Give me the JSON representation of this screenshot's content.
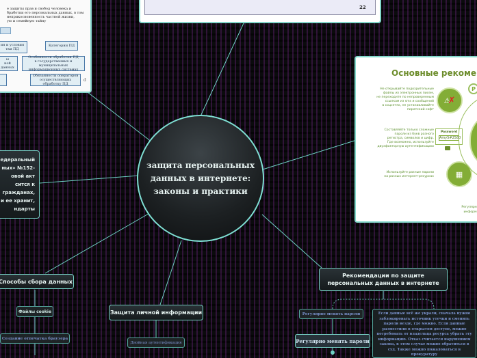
{
  "center": {
    "title": "защита персональных данных в интернете: законы и практики"
  },
  "left_node": {
    "lines": [
      "едеральный",
      "ных» №152-",
      "овой акт",
      "сится к",
      "гражданах,",
      "и ее хранит,",
      "ндарты"
    ]
  },
  "branches": {
    "collection": "Способы сбора данных",
    "protection": "Защита личной информации",
    "recommendations": "Рекомендации по защите персональных данных в интернете"
  },
  "collection_children": {
    "cookies": "Файлы cookie",
    "fingerprint": "Создание отпечатка браузера"
  },
  "protection_children": {
    "twofactor": "Двойная аутентификация"
  },
  "recommendation_children": {
    "change1": "Регулярно менять пароли",
    "change2": "Регулярно менять пароли",
    "leak_text": "Если данные всё же украли, сначала нужно заблокировать источник утечки и сменить пароли везде, где можно. Если данные разместили в открытом доступе, можно потребовать от владельца ресурса убрать эту информацию. Отказ считается нарушением закона, в этом случае можно обратиться в суд. Также можно пожаловаться в прокуратуру"
  },
  "slide_top": {
    "page_number": "22"
  },
  "doc_panel": {
    "intro": "е защиты прав и свобод человека и\nбработки его персональных данных, в том\nнеприкосновенность частной жизни,\nую и семейную тайну",
    "box1": "ия и условия\nтки ПД",
    "box2": "Категории ПД",
    "box3": "ы\nной\nданных",
    "box4": "Особенности обработки ПД\nв государственных и муниципальных\nинформационных системах",
    "box5": "Обязанности операторов\nосуществляющих обработку ПД",
    "stamp": "d"
  },
  "rec_panel": {
    "title": "Основные рекомендаци",
    "tip1": "Не открывайте подозрительные\nфайлы из электронных писем,\nне переходите по непроверенным\nссылкам из sms и сообщений\nв соцсетях, не устанавливайте\nпиратский софт",
    "tip2": "Составляйте только сложные\nпароли из букв разного\nрегистра, символов и цифр.\nГде возможно, используйте\nдвухфакторную аутентификацию",
    "tip3": "Используйте разные пароли\nна разных интернет-ресурсах",
    "password_label": "Password",
    "password_value": "Amy5#2580",
    "footer": "Регулярно\nинформ"
  }
}
